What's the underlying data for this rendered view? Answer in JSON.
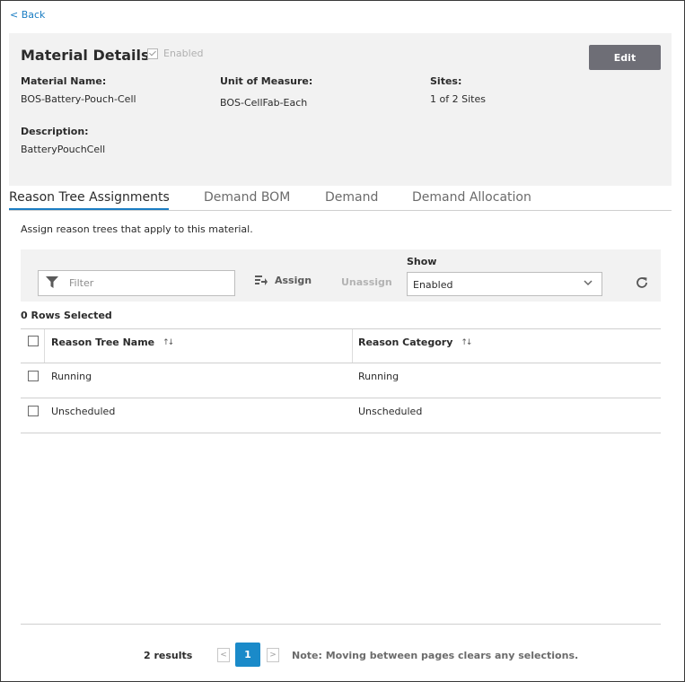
{
  "nav": {
    "back_label": "< Back"
  },
  "details": {
    "title": "Material Details",
    "enabled_label": "Enabled",
    "edit_label": "Edit",
    "material_name_label": "Material Name:",
    "material_name_value": "BOS-Battery-Pouch-Cell",
    "uom_label": "Unit of Measure:",
    "uom_value": "BOS-CellFab-Each",
    "sites_label": "Sites:",
    "sites_value": "1 of 2 Sites",
    "description_label": "Description:",
    "description_value": "BatteryPouchCell"
  },
  "tabs": [
    {
      "label": "Reason Tree Assignments",
      "active": true
    },
    {
      "label": "Demand BOM",
      "active": false
    },
    {
      "label": "Demand",
      "active": false
    },
    {
      "label": "Demand Allocation",
      "active": false
    }
  ],
  "intro_text": "Assign reason trees that apply to this material.",
  "toolbar": {
    "filter_placeholder": "Filter",
    "assign_label": "Assign",
    "unassign_label": "Unassign",
    "show_label": "Show",
    "show_value": "Enabled"
  },
  "rows_selected": "0 Rows Selected",
  "table": {
    "columns": [
      "Reason Tree Name",
      "Reason Category"
    ],
    "rows": [
      {
        "name": "Running",
        "category": "Running"
      },
      {
        "name": "Unscheduled",
        "category": "Unscheduled"
      }
    ]
  },
  "pagination": {
    "results_label": "2  results",
    "current_page": "1",
    "note": "Note: Moving between pages clears any selections."
  },
  "colors": {
    "accent": "#1a8ac9",
    "link": "#1a7dc3",
    "edit_button": "#6e6e76"
  },
  "icons": [
    "filter-icon",
    "assign-icon",
    "chevron-down-icon",
    "refresh-icon",
    "sort-icon",
    "chevron-left-icon",
    "chevron-right-icon",
    "checkmark-icon"
  ]
}
